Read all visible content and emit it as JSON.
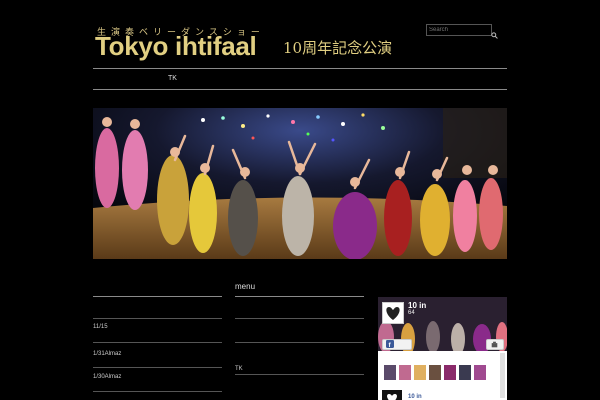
{
  "header": {
    "subtitle_jp": "生演奏ベリーダンスショー",
    "logo_en": "Tokyo ihtifaal",
    "logo_jp": "10周年記念公演"
  },
  "search": {
    "placeholder": "Search",
    "icon": "search-icon"
  },
  "nav": {
    "items": [
      {
        "label": "TK"
      }
    ]
  },
  "hero": {
    "image": "hero-image",
    "alt": "Belly dancers on stage"
  },
  "left_column": {
    "items": [
      {
        "label": "11/15"
      },
      {
        "label": "1/31Almaz"
      },
      {
        "label": "1/30Almaz"
      }
    ]
  },
  "menu_column": {
    "title": "menu",
    "items": [
      {
        "label": "TK"
      }
    ]
  },
  "facebook_widget": {
    "page_name": "10 in",
    "likes": "64",
    "page_name_bottom": "10 in",
    "icons": [
      "facebook-icon",
      "share-icon"
    ]
  },
  "colors": {
    "background": "#000000",
    "gold": "#e1cf82",
    "divider": "#8a8a8a"
  }
}
